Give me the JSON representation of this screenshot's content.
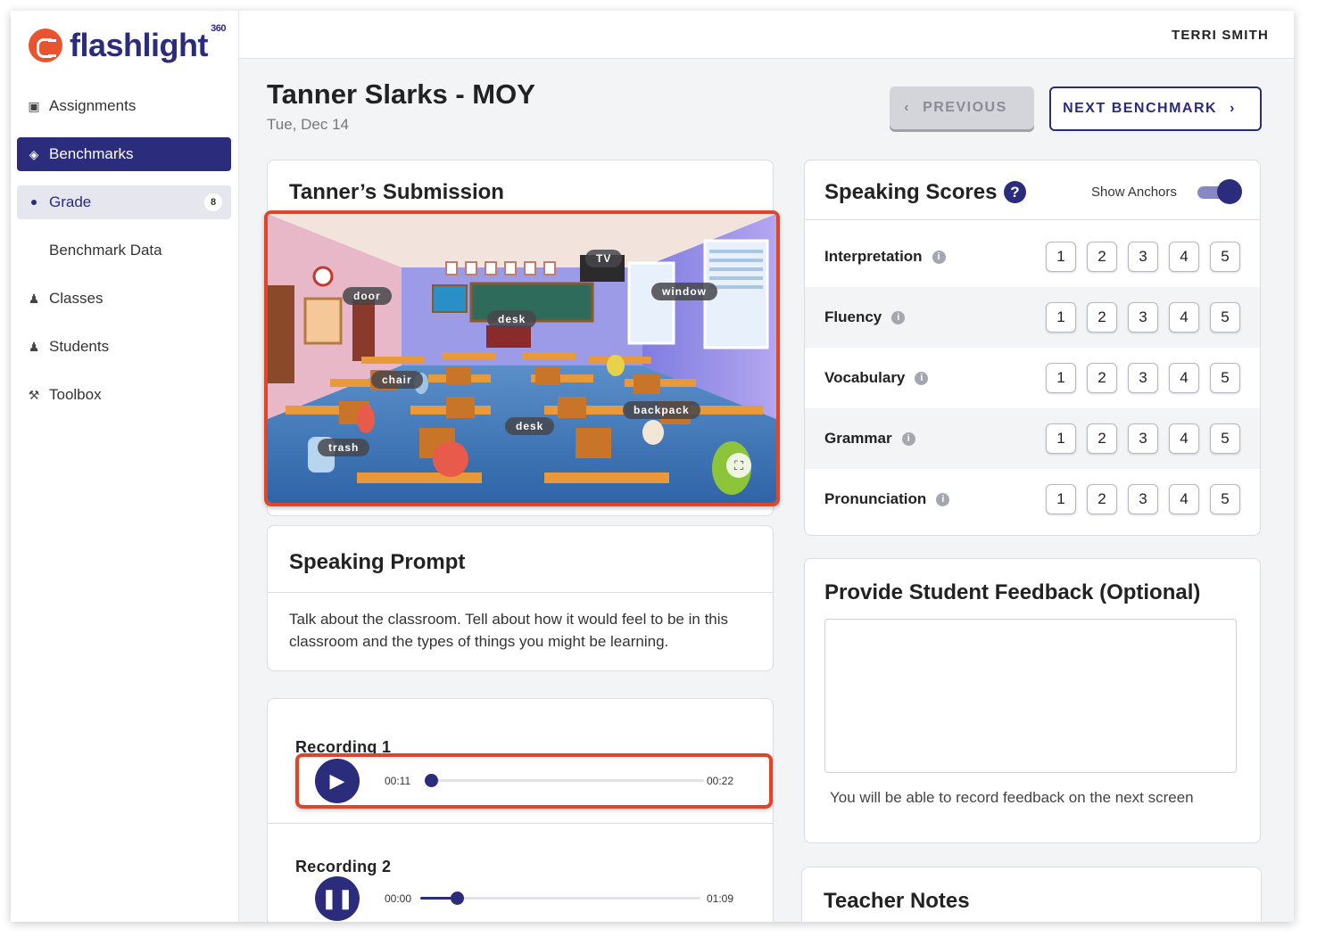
{
  "app": {
    "logo_text": "flashlight",
    "logo_sup": "360",
    "user_name": "TERRI SMITH"
  },
  "sidebar": {
    "items": [
      {
        "label": "Assignments",
        "icon": "image-icon"
      },
      {
        "label": "Benchmarks",
        "icon": "benchmark-icon"
      },
      {
        "label": "Grade",
        "badge": "8"
      },
      {
        "label": "Benchmark Data"
      },
      {
        "label": "Classes",
        "icon": "classes-icon"
      },
      {
        "label": "Students",
        "icon": "students-icon"
      },
      {
        "label": "Toolbox",
        "icon": "tools-icon"
      }
    ]
  },
  "header": {
    "title": "Tanner Slarks - MOY",
    "date": "Tue, Dec 14",
    "prev_label": "PREVIOUS",
    "next_label": "NEXT BENCHMARK"
  },
  "submission": {
    "title": "Tanner’s Submission",
    "labels": [
      "TV",
      "door",
      "window",
      "desk",
      "chair",
      "backpack",
      "desk",
      "trash"
    ]
  },
  "prompt": {
    "title": "Speaking Prompt",
    "text": "Talk about the classroom. Tell about how it would feel to be in this classroom and the types of things you might be learning."
  },
  "recordings": [
    {
      "label": "Recording 1",
      "current": "00:11",
      "duration": "00:22",
      "progress": 0.0,
      "state": "paused"
    },
    {
      "label": "Recording 2",
      "current": "00:00",
      "duration": "01:09",
      "progress": 0.13,
      "state": "playing"
    }
  ],
  "scores": {
    "title": "Speaking Scores",
    "show_anchors_label": "Show Anchors",
    "show_anchors": true,
    "rows": [
      {
        "name": "Interpretation",
        "options": [
          "1",
          "2",
          "3",
          "4",
          "5"
        ]
      },
      {
        "name": "Fluency",
        "options": [
          "1",
          "2",
          "3",
          "4",
          "5"
        ]
      },
      {
        "name": "Vocabulary",
        "options": [
          "1",
          "2",
          "3",
          "4",
          "5"
        ]
      },
      {
        "name": "Grammar",
        "options": [
          "1",
          "2",
          "3",
          "4",
          "5"
        ]
      },
      {
        "name": "Pronunciation",
        "options": [
          "1",
          "2",
          "3",
          "4",
          "5"
        ]
      }
    ]
  },
  "feedback": {
    "title": "Provide Student Feedback (Optional)",
    "note": "You will be able to record feedback on the next screen",
    "value": ""
  },
  "notes": {
    "title": "Teacher Notes"
  },
  "colors": {
    "brand": "#2b2c7c",
    "logo": "#e8542f",
    "highlight": "#e0452a"
  }
}
